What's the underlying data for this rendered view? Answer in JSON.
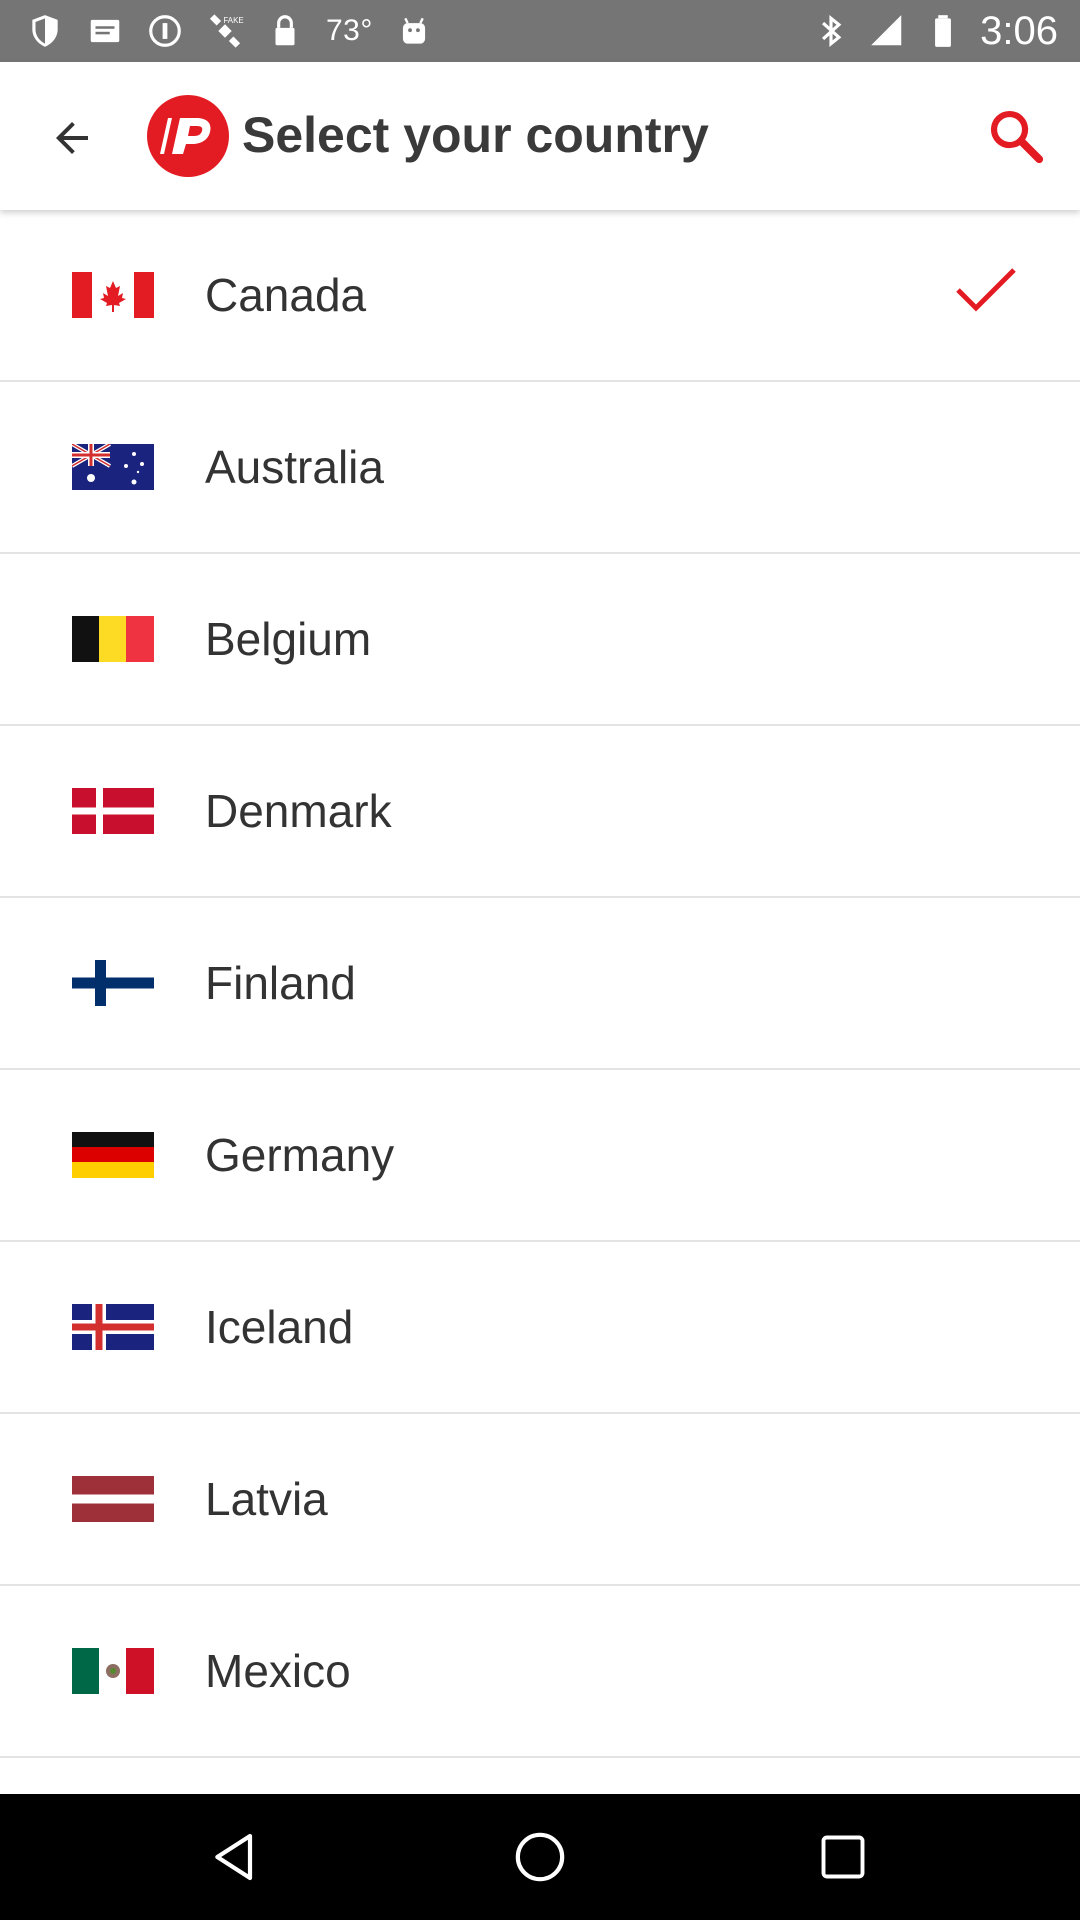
{
  "status_bar": {
    "temperature": "73°",
    "time": "3:06"
  },
  "app_bar": {
    "title": "Select your country",
    "back_icon": "arrow-back-icon",
    "search_icon": "search-icon",
    "logo_icon": "app-logo-icon",
    "accent_color": "#E31B23"
  },
  "countries": [
    {
      "name": "Canada",
      "flag": "canada-flag-icon",
      "selected": true
    },
    {
      "name": "Australia",
      "flag": "australia-flag-icon",
      "selected": false
    },
    {
      "name": "Belgium",
      "flag": "belgium-flag-icon",
      "selected": false
    },
    {
      "name": "Denmark",
      "flag": "denmark-flag-icon",
      "selected": false
    },
    {
      "name": "Finland",
      "flag": "finland-flag-icon",
      "selected": false
    },
    {
      "name": "Germany",
      "flag": "germany-flag-icon",
      "selected": false
    },
    {
      "name": "Iceland",
      "flag": "iceland-flag-icon",
      "selected": false
    },
    {
      "name": "Latvia",
      "flag": "latvia-flag-icon",
      "selected": false
    },
    {
      "name": "Mexico",
      "flag": "mexico-flag-icon",
      "selected": false
    }
  ],
  "nav_bar": {
    "back_icon": "nav-back-icon",
    "home_icon": "nav-home-icon",
    "recents_icon": "nav-recents-icon"
  }
}
